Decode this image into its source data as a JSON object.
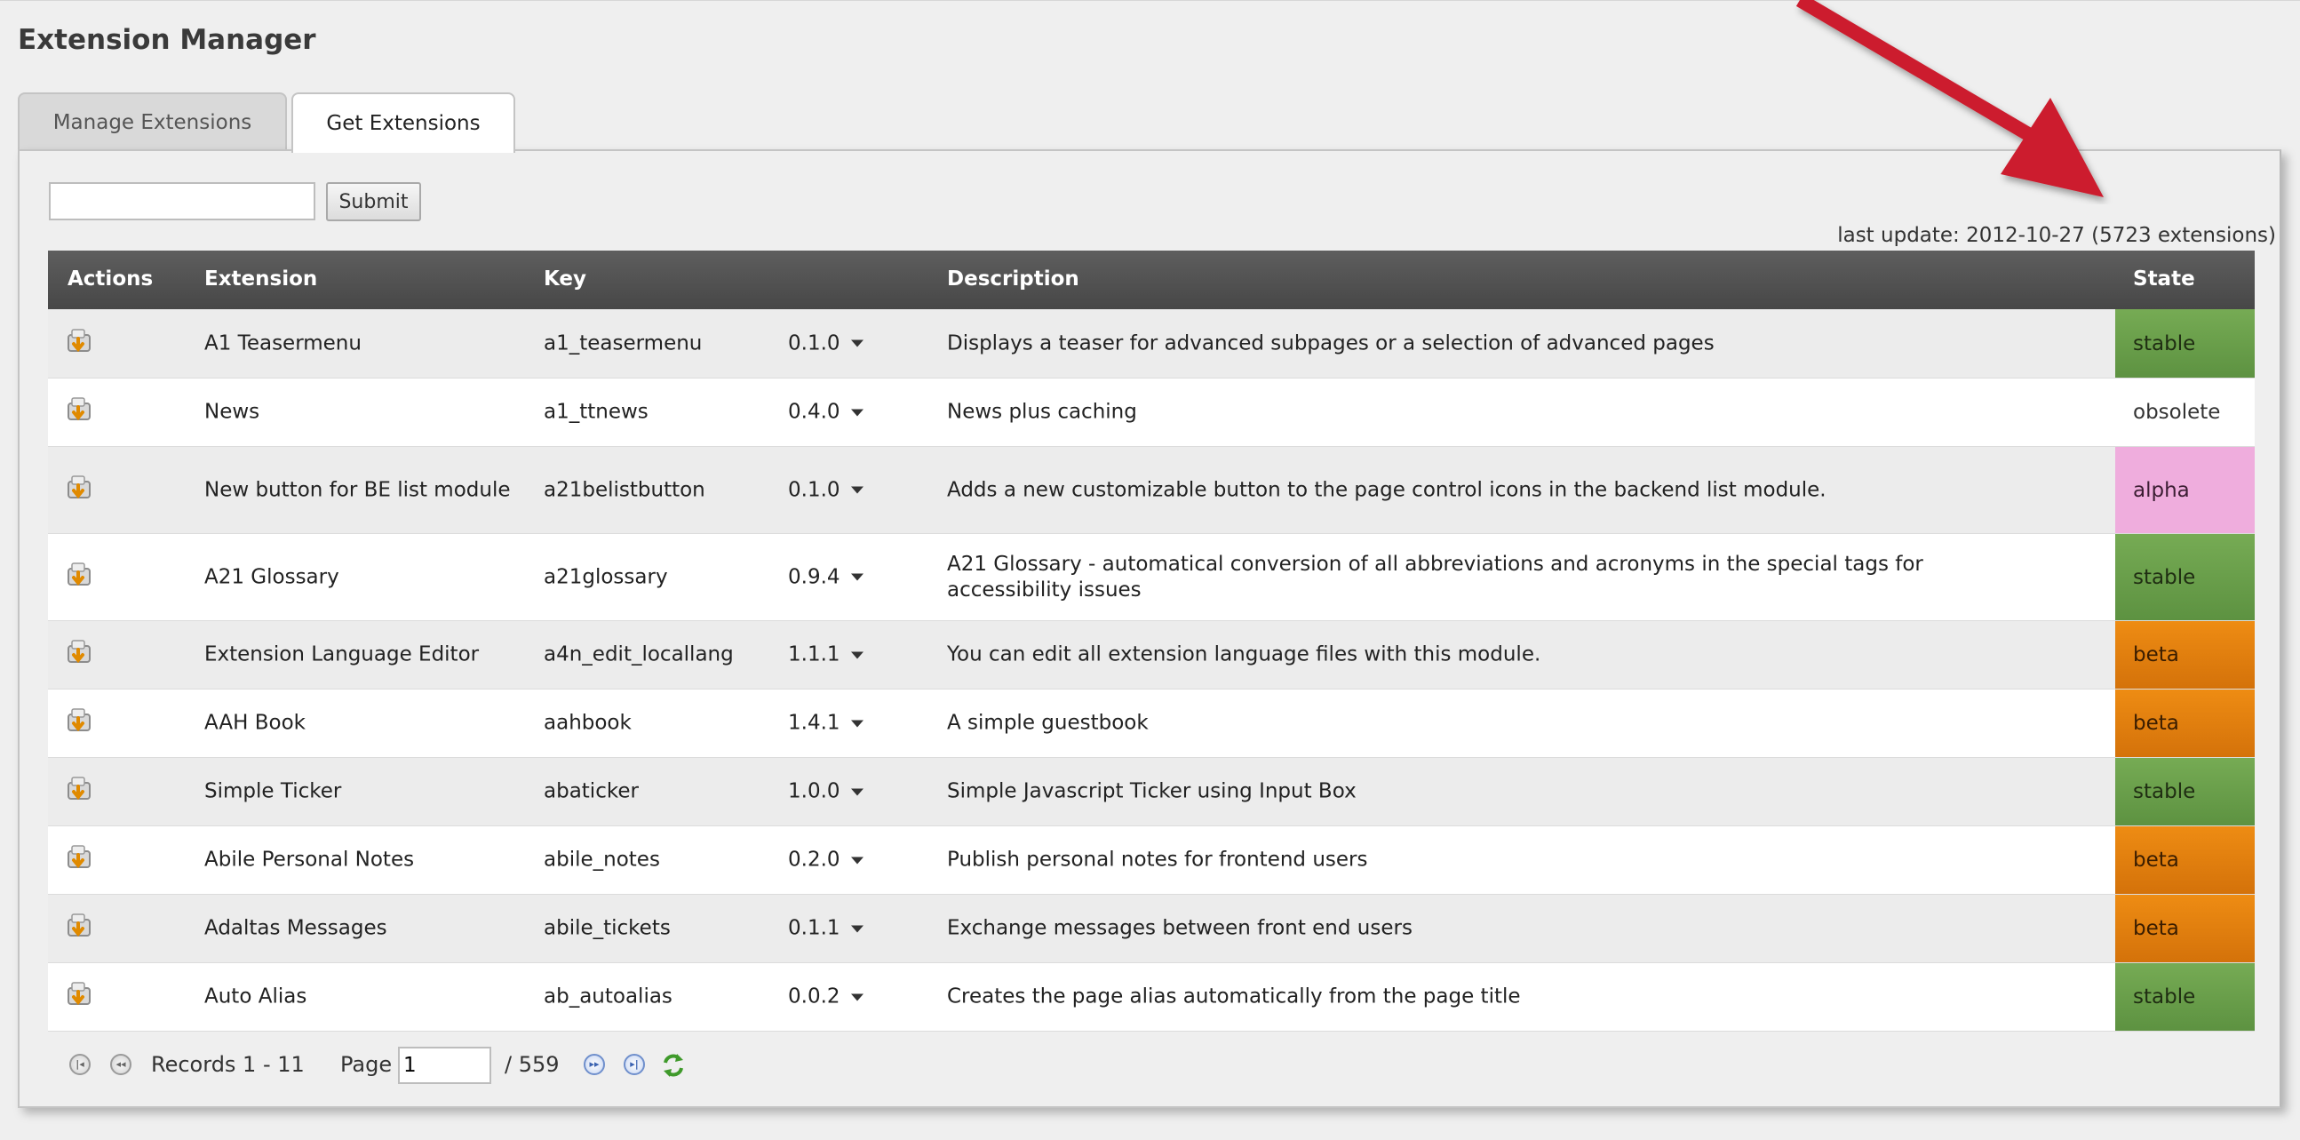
{
  "app": {
    "title": "Extension Manager"
  },
  "tabs": [
    {
      "label": "Manage Extensions",
      "active": false
    },
    {
      "label": "Get Extensions",
      "active": true
    }
  ],
  "search": {
    "value": "",
    "submit_label": "Submit"
  },
  "last_update": "last update: 2012-10-27 (5723 extensions)",
  "table": {
    "headers": {
      "actions": "Actions",
      "extension": "Extension",
      "key": "Key",
      "description": "Description",
      "state": "State"
    },
    "rows": [
      {
        "extension": "A1 Teasermenu",
        "key": "a1_teasermenu",
        "version": "0.1.0",
        "description": "Displays a teaser for advanced subpages or a selection of advanced pages",
        "state": "stable"
      },
      {
        "extension": "News",
        "key": "a1_ttnews",
        "version": "0.4.0",
        "description": "News plus caching",
        "state": "obsolete"
      },
      {
        "extension": "New button for BE list module",
        "key": "a21belistbutton",
        "version": "0.1.0",
        "description": "Adds a new customizable button to the page control icons in the backend list module.",
        "state": "alpha"
      },
      {
        "extension": "A21 Glossary",
        "key": "a21glossary",
        "version": "0.9.4",
        "description": "A21 Glossary - automatical conversion of all abbreviations and acronyms in the special tags for accessibility issues",
        "state": "stable"
      },
      {
        "extension": "Extension Language Editor",
        "key": "a4n_edit_locallang",
        "version": "1.1.1",
        "description": "You can edit all extension language files with this module.",
        "state": "beta"
      },
      {
        "extension": "AAH Book",
        "key": "aahbook",
        "version": "1.4.1",
        "description": "A simple guestbook",
        "state": "beta"
      },
      {
        "extension": "Simple Ticker",
        "key": "abaticker",
        "version": "1.0.0",
        "description": "Simple Javascript Ticker using Input Box",
        "state": "stable"
      },
      {
        "extension": "Abile Personal Notes",
        "key": "abile_notes",
        "version": "0.2.0",
        "description": "Publish personal notes for frontend users",
        "state": "beta"
      },
      {
        "extension": "Adaltas Messages",
        "key": "abile_tickets",
        "version": "0.1.1",
        "description": "Exchange messages between front end users",
        "state": "beta"
      },
      {
        "extension": "Auto Alias",
        "key": "ab_autoalias",
        "version": "0.0.2",
        "description": "Creates the page alias automatically from the page title",
        "state": "stable"
      }
    ]
  },
  "pager": {
    "records_label": "Records 1 - 11",
    "page_label": "Page",
    "page_value": "1",
    "total_label": "/ 559"
  },
  "colors": {
    "stable": "#6a9f4b",
    "alpha": "#efaddd",
    "beta": "#e57f10",
    "annotation_arrow": "#cc1f2e"
  }
}
